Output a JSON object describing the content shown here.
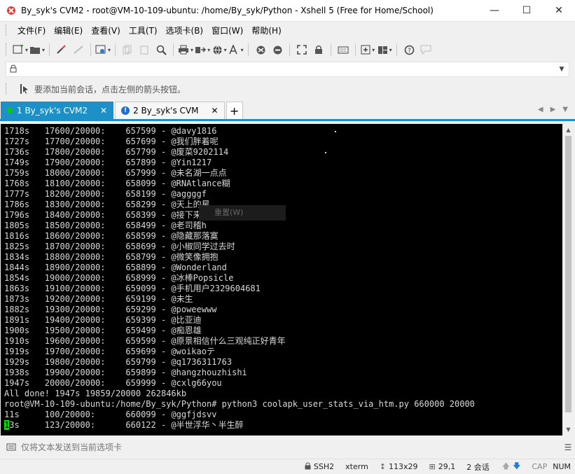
{
  "window": {
    "title": "By_syk's CVM2 - root@VM-10-109-ubuntu: /home/By_syk/Python - Xshell 5 (Free for Home/School)",
    "minimize": "—",
    "maximize": "☐",
    "close": "✕"
  },
  "menu": {
    "items": [
      "文件(F)",
      "编辑(E)",
      "查看(V)",
      "工具(T)",
      "选项卡(B)",
      "窗口(W)",
      "帮助(H)"
    ]
  },
  "address": {
    "value": ""
  },
  "links": {
    "hint": "要添加当前会话，点击左侧的箭头按钮。"
  },
  "tabs": [
    {
      "label": "1 By_syk's CVM2",
      "status": "connected"
    },
    {
      "label": "2 By_syk's CVM",
      "status": "info"
    }
  ],
  "terminal": {
    "lines": [
      "1718s   17600/20000:    657599 - @davy1816",
      "1727s   17700/20000:    657699 - @我们胖着呢",
      "1736s   17800/20000:    657799 - @废菜9202114",
      "1749s   17900/20000:    657899 - @Yin1217",
      "1759s   18000/20000:    657999 - @未名湖一点点",
      "1768s   18100/20000:    658099 - @RNAtlance糊",
      "1777s   18200/20000:    658199 - @aggggf",
      "1786s   18300/20000:    658299 - @天上的星",
      "1796s   18400/20000:    658399 - @接下来",
      "1805s   18500/20000:    658499 - @老司稽h",
      "1816s   18600/20000:    658599 - @隐藏那落寞",
      "1825s   18700/20000:    658699 - @小椒同学过去时",
      "1834s   18800/20000:    658799 - @微笑像拥抱",
      "1844s   18900/20000:    658899 - @Wonderland",
      "1854s   19000/20000:    658999 - @冰棒Popsicle",
      "1863s   19100/20000:    659099 - @手机用户2329604681",
      "1873s   19200/20000:    659199 - @未生",
      "1882s   19300/20000:    659299 - @poweewww",
      "1891s   19400/20000:    659399 - @比亚迪",
      "1900s   19500/20000:    659499 - @痴恩雄",
      "1910s   19600/20000:    659599 - @原景相信什么三观纯正好青年",
      "1919s   19700/20000:    659699 - @woikaoテ",
      "1929s   19800/20000:    659799 - @q1736311763",
      "1938s   19900/20000:    659899 - @hangzhouzhishi",
      "1947s   20000/20000:    659999 - @cxlg66you",
      "All done! 1947s 19859/20000 262846kb",
      "root@VM-10-109-ubuntu:/home/By_syk/Python# python3 coolapk_user_stats_via_htm.py 660000 20000",
      "11s     100/20000:      660099 - @ggfjdsvv"
    ],
    "last_line_cursor_char": "1",
    "last_line_rest": "3s     123/20000:      660122 - @半世浮华丶半生醉",
    "ghost_menu": "重置(W)"
  },
  "compose": {
    "placeholder": "仅将文本发送到当前选项卡"
  },
  "status": {
    "protocol": "SSH2",
    "terminal_type": "xterm",
    "size": "113x29",
    "cursor_pos": "29,1",
    "sessions": "2 会话",
    "cap": "CAP",
    "num": "NUM"
  }
}
